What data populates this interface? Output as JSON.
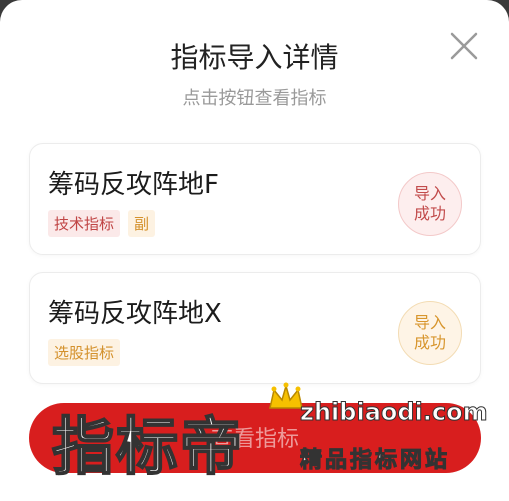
{
  "modal": {
    "title": "指标导入详情",
    "subtitle": "点击按钮查看指标",
    "close_icon": "close-icon"
  },
  "items": [
    {
      "name": "筹码反攻阵地F",
      "tags": [
        "技术指标",
        "副"
      ],
      "status": "导入成功",
      "status_color": "#c24c4c"
    },
    {
      "name": "筹码反攻阵地X",
      "tags": [
        "选股指标"
      ],
      "status": "导入成功",
      "status_color": "#d8962e"
    }
  ],
  "button": {
    "label": "查看指标",
    "color": "#d81e1e"
  },
  "watermark": {
    "big": "指标帝",
    "url": "zhibiaodi.com",
    "slogan": "精品指标网站"
  }
}
